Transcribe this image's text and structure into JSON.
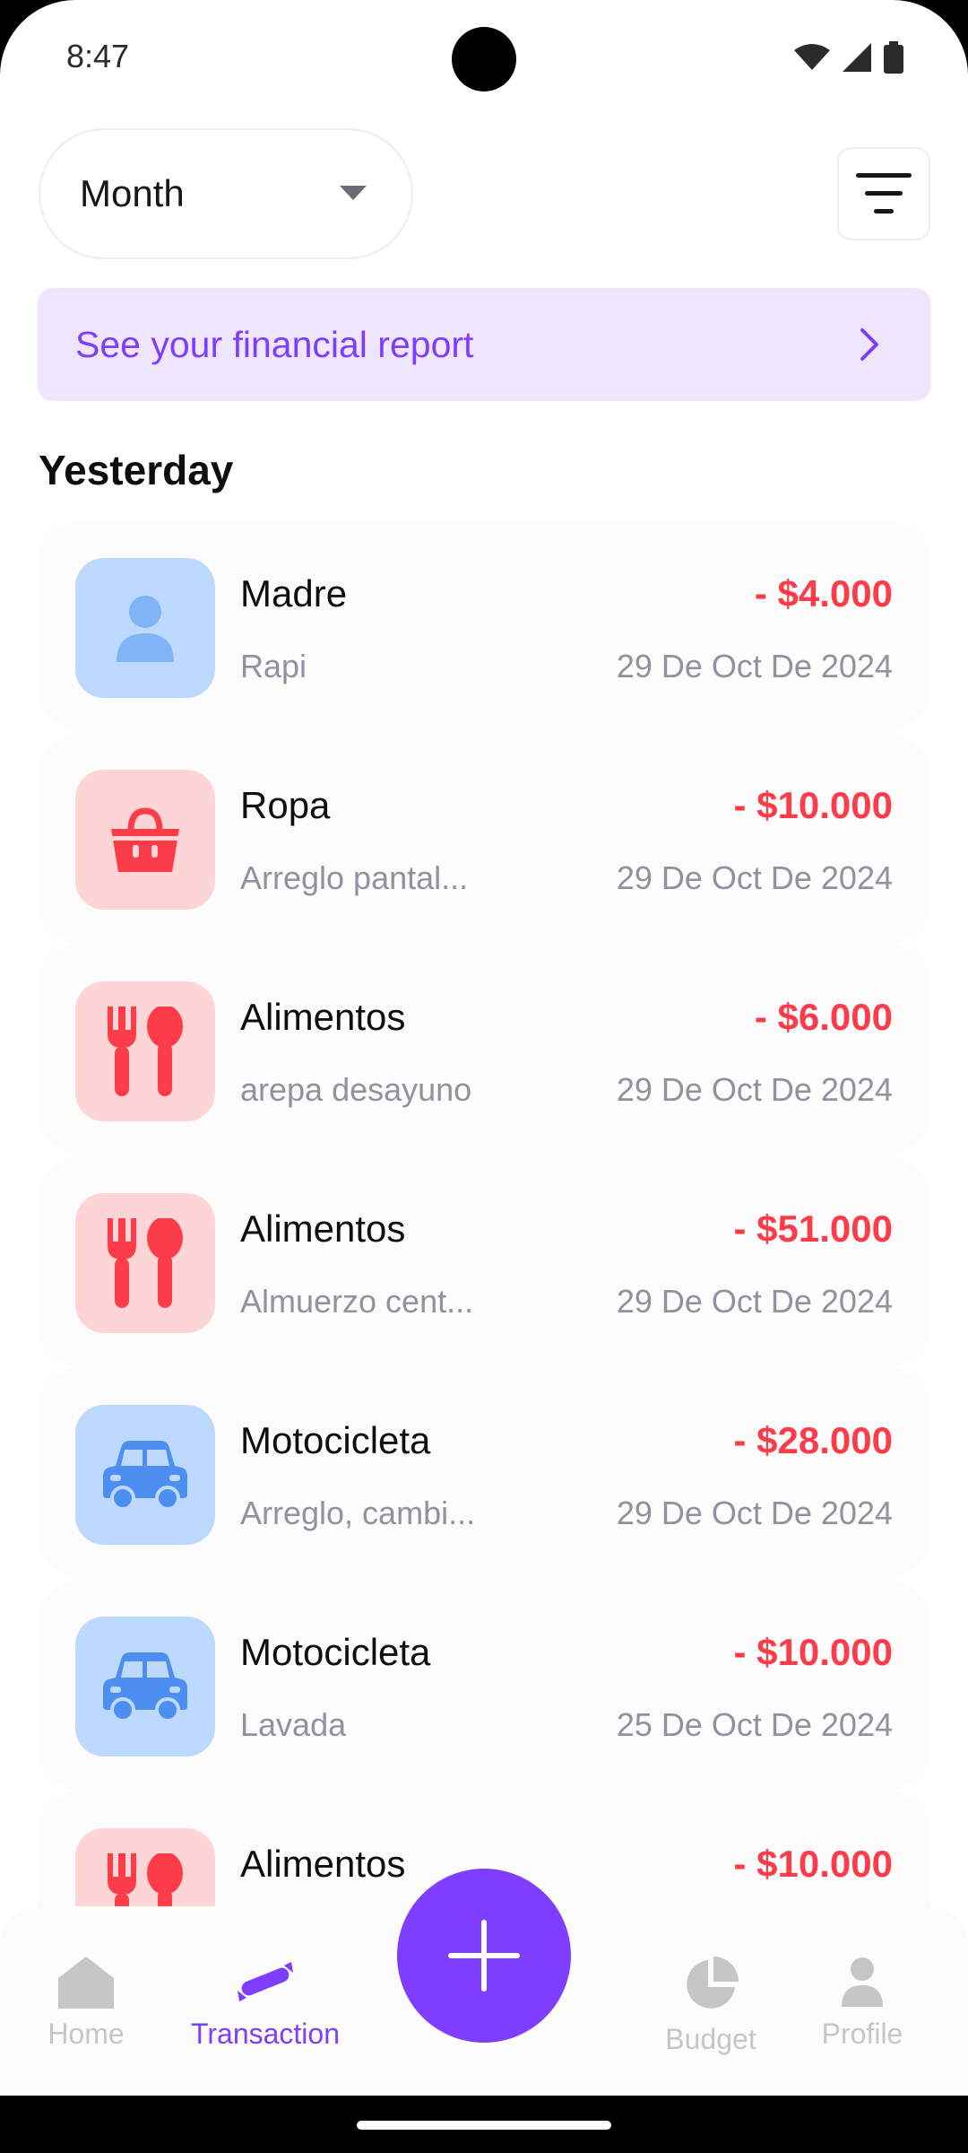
{
  "status_bar": {
    "time": "8:47"
  },
  "header": {
    "period_select": {
      "value": "Month"
    },
    "report_banner": {
      "label": "See your financial report"
    }
  },
  "section": {
    "title": "Yesterday"
  },
  "transactions": [
    {
      "category": "Madre",
      "note": "Rapi",
      "amount": "- $4.000",
      "date": "29 De Oct De 2024",
      "icon": "user-icon",
      "color": "blue"
    },
    {
      "category": "Ropa",
      "note": "Arreglo pantal...",
      "amount": "- $10.000",
      "date": "29 De Oct De 2024",
      "icon": "shopping-basket-icon",
      "color": "red"
    },
    {
      "category": "Alimentos",
      "note": "arepa desayuno",
      "amount": "- $6.000",
      "date": "29 De Oct De 2024",
      "icon": "food-icon",
      "color": "red"
    },
    {
      "category": "Alimentos",
      "note": "Almuerzo cent...",
      "amount": "- $51.000",
      "date": "29 De Oct De 2024",
      "icon": "food-icon",
      "color": "red"
    },
    {
      "category": "Motocicleta",
      "note": "Arreglo, cambi...",
      "amount": "- $28.000",
      "date": "29 De Oct De 2024",
      "icon": "car-icon",
      "color": "blue"
    },
    {
      "category": "Motocicleta",
      "note": "Lavada",
      "amount": "- $10.000",
      "date": "25 De Oct De 2024",
      "icon": "car-icon",
      "color": "blue"
    },
    {
      "category": "Alimentos",
      "note": "",
      "amount": "- $10.000",
      "date": "",
      "icon": "food-icon",
      "color": "red"
    }
  ],
  "bottom_nav": {
    "items": [
      {
        "label": "Home",
        "icon": "home-icon",
        "active": false
      },
      {
        "label": "Transaction",
        "icon": "transaction-icon",
        "active": true
      },
      {
        "label": "Budget",
        "icon": "pie-chart-icon",
        "active": false
      },
      {
        "label": "Profile",
        "icon": "user-icon",
        "active": false
      }
    ],
    "fab_icon": "plus-icon"
  },
  "colors": {
    "accent": "#7f3dff",
    "expense": "#fd3c4a",
    "blue_bg": "#bdd9ff",
    "red_bg": "#fdd5d7"
  }
}
